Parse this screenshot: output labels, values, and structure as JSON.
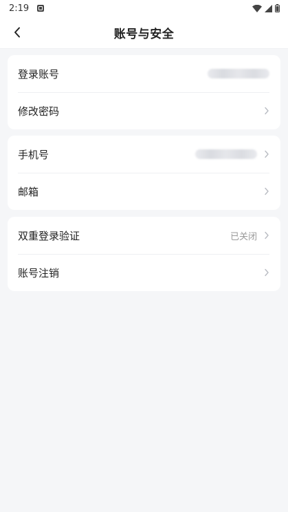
{
  "status": {
    "time": "2:19"
  },
  "header": {
    "title": "账号与安全"
  },
  "account_card": {
    "login_label": "登录账号",
    "password_label": "修改密码"
  },
  "contact_card": {
    "phone_label": "手机号",
    "email_label": "邮箱"
  },
  "security_card": {
    "two_factor_label": "双重登录验证",
    "two_factor_value": "已关闭",
    "deactivate_label": "账号注销"
  }
}
